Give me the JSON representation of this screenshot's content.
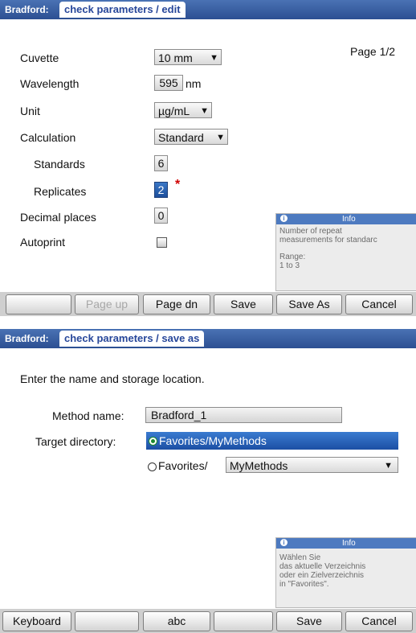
{
  "screen1": {
    "title_prefix": "Bradford:",
    "title_tab": "check parameters / edit",
    "page_indicator": "Page 1/2",
    "params": {
      "cuvette_label": "Cuvette",
      "cuvette_value": "10 mm",
      "wavelength_label": "Wavelength",
      "wavelength_value": "595",
      "wavelength_unit": "nm",
      "unit_label": "Unit",
      "unit_value": "µg/mL",
      "calculation_label": "Calculation",
      "calculation_value": "Standard",
      "standards_label": "Standards",
      "standards_value": "6",
      "replicates_label": "Replicates",
      "replicates_value": "2",
      "replicates_marker": "*",
      "decimal_label": "Decimal places",
      "decimal_value": "0",
      "autoprint_label": "Autoprint"
    },
    "info": {
      "title": "Info",
      "line1": "Number of repeat",
      "line2": "measurements for standarc",
      "line3": "Range:",
      "line4": "1 to 3"
    },
    "buttons": {
      "blank": "",
      "page_up": "Page up",
      "page_dn": "Page dn",
      "save": "Save",
      "save_as": "Save As",
      "cancel": "Cancel"
    }
  },
  "screen2": {
    "title_prefix": "Bradford:",
    "title_tab": "check parameters / save as",
    "instruction": "Enter the name and storage location.",
    "method_name_label": "Method name:",
    "method_name_value": "Bradford_1",
    "target_dir_label": "Target directory:",
    "option1": "Favorites/MyMethods",
    "option2_prefix": "Favorites/",
    "option2_value": "MyMethods",
    "info": {
      "title": "Info",
      "line1": "Wählen Sie",
      "line2": "das aktuelle Verzeichnis",
      "line3": "oder ein Zielverzeichnis",
      "line4": "in \"Favorites\"."
    },
    "buttons": {
      "keyboard": "Keyboard",
      "blank1": "",
      "abc": "abc",
      "blank2": "",
      "save": "Save",
      "cancel": "Cancel"
    }
  }
}
